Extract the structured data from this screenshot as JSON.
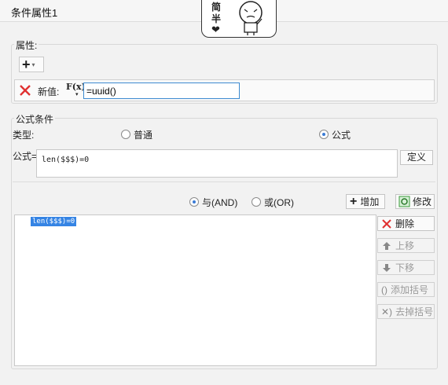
{
  "window": {
    "title": "条件属性1"
  },
  "mascot": {
    "chars": [
      "简",
      "半"
    ]
  },
  "property": {
    "legend": "属性:",
    "new_value_label": "新值:",
    "fx_label": "F(x)",
    "new_value": "=uuid()"
  },
  "formula_condition": {
    "legend": "公式条件",
    "type_label": "类型:",
    "type_options": {
      "normal": "普通",
      "formula": "公式"
    },
    "type_selected": "公式",
    "formula_label": "公式=",
    "formula_value": "len($$$)=0",
    "define_button": "定义",
    "logic_options": {
      "and": "与(AND)",
      "or": "或(OR)"
    },
    "logic_selected": "与(AND)",
    "add_button": "增加",
    "modify_button": "修改",
    "conditions": [
      "len($$$)=0"
    ],
    "side_buttons": {
      "delete": "删除",
      "move_up": "上移",
      "move_down": "下移",
      "add_bracket": "添加括号",
      "remove_bracket": "去掉括号"
    }
  },
  "colors": {
    "accent": "#3584e4",
    "delete_red": "#e03030",
    "modify_green": "#3a9a3a"
  }
}
